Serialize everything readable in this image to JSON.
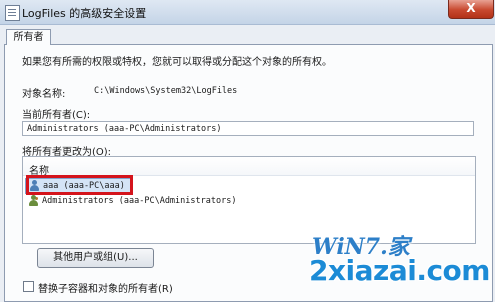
{
  "window": {
    "title": "LogFiles 的高级安全设置",
    "close_label": "X"
  },
  "tabs": [
    {
      "label": "所有者"
    }
  ],
  "main": {
    "intro": "如果您有所需的权限或特权，您就可以取得或分配这个对象的所有权。",
    "object_name_label": "对象名称:",
    "object_name_value": "C:\\Windows\\System32\\LogFiles",
    "current_owner_label": "当前所有者(C):",
    "current_owner_value": "Administrators (aaa-PC\\Administrators)",
    "change_owner_label": "将所有者更改为(O):",
    "list_header": "名称",
    "owners": [
      {
        "name": "aaa (aaa-PC\\aaa)",
        "icon": "user-icon",
        "selected": true
      },
      {
        "name": "Administrators (aaa-PC\\Administrators)",
        "icon": "group-icon",
        "selected": false
      }
    ],
    "other_users_button": "其他用户或组(U)...",
    "replace_owner_checkbox": "替换子容器和对象的所有者(R)"
  },
  "watermark": {
    "logo": "WiN7.家",
    "site": "2xiazai.com"
  },
  "colors": {
    "highlight_box": "#d4141c",
    "selection": "#d4e4f6",
    "close_button": "#c8492f"
  }
}
